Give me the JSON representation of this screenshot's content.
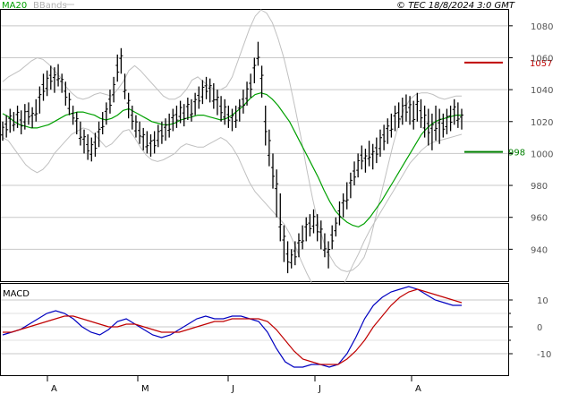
{
  "header": {
    "ma_label": "MA20",
    "bbands_label": "BBands",
    "copyright": "© TEC 18/8/2024 3:0 GMT",
    "ma_color": "#00a000",
    "bbands_color": "#c0c0c0"
  },
  "chart_data": [
    {
      "type": "ohlc",
      "title": "",
      "y_ticks": [
        "1080",
        "1060",
        "1040",
        "1020",
        "1000",
        "980",
        "960",
        "940"
      ],
      "ylim": [
        920,
        1090
      ],
      "x_ticks": [
        "A",
        "M",
        "J",
        "J",
        "A"
      ],
      "grid": true,
      "levels": [
        {
          "label": "1057",
          "value": 1057,
          "color": "#c00000"
        },
        {
          "label": "998",
          "value": 1001,
          "color": "#008000"
        }
      ],
      "price_bars": [
        [
          1020,
          1008
        ],
        [
          1024,
          1010
        ],
        [
          1028,
          1013
        ],
        [
          1026,
          1014
        ],
        [
          1030,
          1016
        ],
        [
          1027,
          1012
        ],
        [
          1031,
          1015
        ],
        [
          1032,
          1018
        ],
        [
          1029,
          1016
        ],
        [
          1034,
          1020
        ],
        [
          1042,
          1025
        ],
        [
          1050,
          1033
        ],
        [
          1052,
          1036
        ],
        [
          1055,
          1040
        ],
        [
          1054,
          1038
        ],
        [
          1056,
          1042
        ],
        [
          1050,
          1038
        ],
        [
          1045,
          1030
        ],
        [
          1038,
          1024
        ],
        [
          1030,
          1018
        ],
        [
          1026,
          1012
        ],
        [
          1020,
          1005
        ],
        [
          1015,
          1000
        ],
        [
          1012,
          996
        ],
        [
          1010,
          995
        ],
        [
          1013,
          998
        ],
        [
          1020,
          1004
        ],
        [
          1026,
          1012
        ],
        [
          1032,
          1018
        ],
        [
          1040,
          1025
        ],
        [
          1048,
          1032
        ],
        [
          1062,
          1045
        ],
        [
          1066,
          1050
        ],
        [
          1050,
          1034
        ],
        [
          1038,
          1022
        ],
        [
          1030,
          1015
        ],
        [
          1024,
          1010
        ],
        [
          1020,
          1006
        ],
        [
          1016,
          1002
        ],
        [
          1014,
          1000
        ],
        [
          1012,
          998
        ],
        [
          1014,
          1000
        ],
        [
          1018,
          1004
        ],
        [
          1020,
          1006
        ],
        [
          1022,
          1008
        ],
        [
          1025,
          1010
        ],
        [
          1028,
          1014
        ],
        [
          1030,
          1016
        ],
        [
          1033,
          1019
        ],
        [
          1031,
          1017
        ],
        [
          1035,
          1021
        ],
        [
          1034,
          1020
        ],
        [
          1038,
          1024
        ],
        [
          1042,
          1028
        ],
        [
          1046,
          1031
        ],
        [
          1048,
          1034
        ],
        [
          1047,
          1032
        ],
        [
          1044,
          1028
        ],
        [
          1040,
          1024
        ],
        [
          1036,
          1020
        ],
        [
          1034,
          1018
        ],
        [
          1030,
          1016
        ],
        [
          1028,
          1014
        ],
        [
          1030,
          1016
        ],
        [
          1034,
          1020
        ],
        [
          1040,
          1025
        ],
        [
          1045,
          1030
        ],
        [
          1050,
          1035
        ],
        [
          1060,
          1044
        ],
        [
          1070,
          1055
        ],
        [
          1055,
          1035
        ],
        [
          1030,
          1005
        ],
        [
          1015,
          992
        ],
        [
          1000,
          978
        ],
        [
          990,
          960
        ],
        [
          975,
          945
        ],
        [
          955,
          932
        ],
        [
          945,
          925
        ],
        [
          940,
          928
        ],
        [
          945,
          930
        ],
        [
          950,
          935
        ],
        [
          955,
          940
        ],
        [
          960,
          945
        ],
        [
          962,
          948
        ],
        [
          965,
          950
        ],
        [
          962,
          945
        ],
        [
          958,
          940
        ],
        [
          950,
          935
        ],
        [
          945,
          928
        ],
        [
          955,
          940
        ],
        [
          960,
          948
        ],
        [
          970,
          955
        ],
        [
          975,
          960
        ],
        [
          982,
          965
        ],
        [
          988,
          972
        ],
        [
          995,
          980
        ],
        [
          1000,
          985
        ],
        [
          1005,
          990
        ],
        [
          1003,
          988
        ],
        [
          1008,
          992
        ],
        [
          1006,
          990
        ],
        [
          1010,
          994
        ],
        [
          1015,
          998
        ],
        [
          1018,
          1002
        ],
        [
          1022,
          1006
        ],
        [
          1025,
          1010
        ],
        [
          1030,
          1014
        ],
        [
          1032,
          1016
        ],
        [
          1035,
          1018
        ],
        [
          1037,
          1020
        ],
        [
          1036,
          1018
        ],
        [
          1033,
          1015
        ],
        [
          1038,
          1020
        ],
        [
          1034,
          1016
        ],
        [
          1030,
          1010
        ],
        [
          1028,
          1005
        ],
        [
          1025,
          1002
        ],
        [
          1030,
          1008
        ],
        [
          1028,
          1006
        ],
        [
          1025,
          1010
        ],
        [
          1028,
          1012
        ],
        [
          1030,
          1014
        ],
        [
          1034,
          1018
        ],
        [
          1032,
          1016
        ],
        [
          1028,
          1015
        ]
      ],
      "ma20": [
        1025,
        1023,
        1020,
        1018,
        1017,
        1016,
        1016,
        1017,
        1018,
        1020,
        1022,
        1024,
        1025,
        1026,
        1026,
        1025,
        1024,
        1022,
        1021,
        1022,
        1024,
        1027,
        1028,
        1026,
        1024,
        1022,
        1020,
        1019,
        1018,
        1018,
        1019,
        1021,
        1022,
        1023,
        1024,
        1024,
        1023,
        1022,
        1021,
        1022,
        1024,
        1027,
        1030,
        1034,
        1037,
        1038,
        1037,
        1034,
        1030,
        1025,
        1020,
        1013,
        1006,
        999,
        992,
        985,
        977,
        970,
        964,
        960,
        957,
        955,
        954,
        956,
        960,
        965,
        970,
        976,
        982,
        988,
        994,
        1000,
        1006,
        1012,
        1016,
        1019,
        1021,
        1022,
        1023,
        1024,
        1024
      ],
      "bb_upper": [
        1045,
        1048,
        1050,
        1052,
        1055,
        1058,
        1060,
        1059,
        1056,
        1052,
        1048,
        1042,
        1038,
        1035,
        1034,
        1035,
        1037,
        1038,
        1037,
        1036,
        1040,
        1045,
        1052,
        1055,
        1052,
        1048,
        1044,
        1040,
        1036,
        1034,
        1034,
        1036,
        1040,
        1046,
        1048,
        1045,
        1042,
        1040,
        1040,
        1042,
        1048,
        1058,
        1068,
        1078,
        1086,
        1090,
        1088,
        1082,
        1072,
        1060,
        1045,
        1028,
        1010,
        990,
        972,
        956,
        944,
        936,
        930,
        927,
        926,
        927,
        930,
        935,
        945,
        960,
        975,
        990,
        1005,
        1018,
        1028,
        1034,
        1037,
        1038,
        1038,
        1037,
        1035,
        1034,
        1035,
        1036,
        1036
      ],
      "bb_lower": [
        1010,
        1008,
        1003,
        998,
        993,
        990,
        988,
        990,
        994,
        1000,
        1004,
        1008,
        1012,
        1014,
        1016,
        1015,
        1012,
        1008,
        1004,
        1006,
        1010,
        1014,
        1015,
        1010,
        1004,
        999,
        996,
        995,
        996,
        998,
        1000,
        1004,
        1006,
        1005,
        1004,
        1004,
        1006,
        1008,
        1010,
        1008,
        1004,
        998,
        990,
        982,
        976,
        972,
        968,
        964,
        960,
        956,
        950,
        942,
        933,
        925,
        918,
        912,
        908,
        907,
        910,
        915,
        922,
        930,
        937,
        945,
        952,
        958,
        964,
        970,
        976,
        982,
        988,
        994,
        998,
        1002,
        1005,
        1007,
        1008,
        1009,
        1010,
        1011,
        1012
      ]
    },
    {
      "type": "line",
      "title": "MACD",
      "y_ticks": [
        "10",
        "0",
        "-10"
      ],
      "ylim": [
        -18,
        16
      ],
      "grid": true,
      "series": [
        {
          "color": "#0000c0",
          "values": [
            -3,
            -2,
            -1,
            1,
            3,
            5,
            6,
            5,
            3,
            0,
            -2,
            -3,
            -1,
            2,
            3,
            1,
            -1,
            -3,
            -4,
            -3,
            -1,
            1,
            3,
            4,
            3,
            3,
            4,
            4,
            3,
            2,
            -2,
            -8,
            -13,
            -15,
            -15,
            -14,
            -14,
            -15,
            -14,
            -10,
            -4,
            3,
            8,
            11,
            13,
            14,
            15,
            14,
            12,
            10,
            9,
            8,
            8
          ]
        },
        {
          "color": "#c00000",
          "values": [
            -2,
            -2,
            -1,
            0,
            1,
            2,
            3,
            4,
            4,
            3,
            2,
            1,
            0,
            0,
            1,
            1,
            0,
            -1,
            -2,
            -2,
            -2,
            -1,
            0,
            1,
            2,
            2,
            3,
            3,
            3,
            3,
            2,
            -1,
            -5,
            -9,
            -12,
            -13,
            -14,
            -14,
            -14,
            -12,
            -9,
            -5,
            0,
            4,
            8,
            11,
            13,
            14,
            13,
            12,
            11,
            10,
            9
          ]
        }
      ]
    }
  ]
}
